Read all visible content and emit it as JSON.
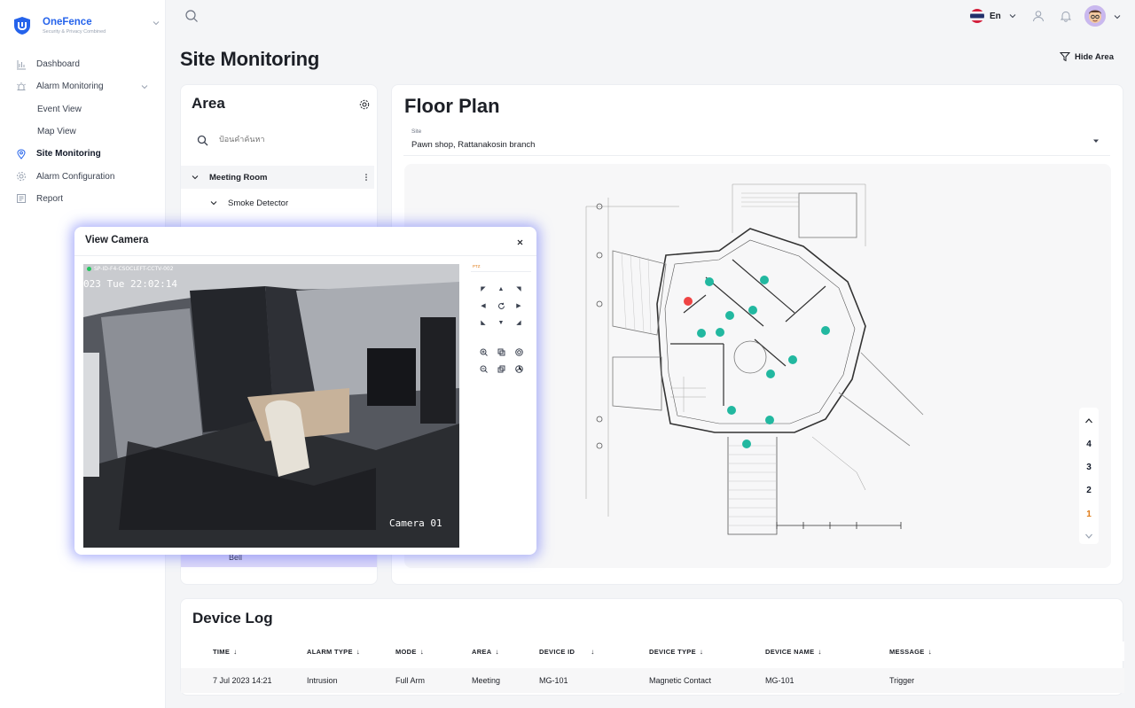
{
  "brand": {
    "name": "OneFence",
    "tagline": "Security & Privacy Combined"
  },
  "sidebar": {
    "items": [
      {
        "label": "Dashboard",
        "icon": "chart-icon"
      },
      {
        "label": "Alarm Monitoring",
        "icon": "alarm-icon"
      },
      {
        "label": "Event View"
      },
      {
        "label": "Map View"
      },
      {
        "label": "Site Monitoring",
        "icon": "location-pin-icon"
      },
      {
        "label": "Alarm Configuration",
        "icon": "gear-icon"
      },
      {
        "label": "Report",
        "icon": "report-icon"
      }
    ]
  },
  "topbar": {
    "language": "En"
  },
  "page": {
    "title": "Site Monitoring",
    "hide_area": "Hide Area"
  },
  "area": {
    "title": "Area",
    "search_placeholder": "ป้อนคำค้นหา",
    "tree": [
      {
        "label": "Meeting Room"
      },
      {
        "label": "Smoke Detector"
      },
      {
        "label": "Bell"
      }
    ]
  },
  "floor_plan": {
    "title": "Floor Plan",
    "site_label": "Site",
    "site_value": "Pawn shop, Rattanakosin branch",
    "floors": [
      "4",
      "3",
      "2",
      "1"
    ],
    "active_floor": "1",
    "device_counts": {
      "normal": 12,
      "alarm": 1
    }
  },
  "device_log": {
    "title": "Device Log",
    "columns": [
      "TIME",
      "ALARM TYPE",
      "MODE",
      "AREA",
      "DEVICE ID",
      "DEVICE TYPE",
      "DEVICE NAME",
      "MESSAGE"
    ],
    "rows": [
      [
        "7 Jul 2023 14:21",
        "Intrusion",
        "Full Arm",
        "Meeting",
        "MG-101",
        "Magnetic Contact",
        "MG-101",
        "Trigger"
      ]
    ]
  },
  "camera_modal": {
    "title": "View Camera",
    "camera_id": "SP-ID-F4-CSOCLEFT-CCTV-002",
    "timestamp": "023 Tue 22:02:14",
    "camera_name": "Camera 01",
    "ptz_label": "PTZ"
  },
  "colors": {
    "accent": "#2563eb",
    "alarm": "#ef4444",
    "device": "#22b8a0",
    "active_floor": "#e07b16",
    "modal_glow": "#6c75f5"
  }
}
